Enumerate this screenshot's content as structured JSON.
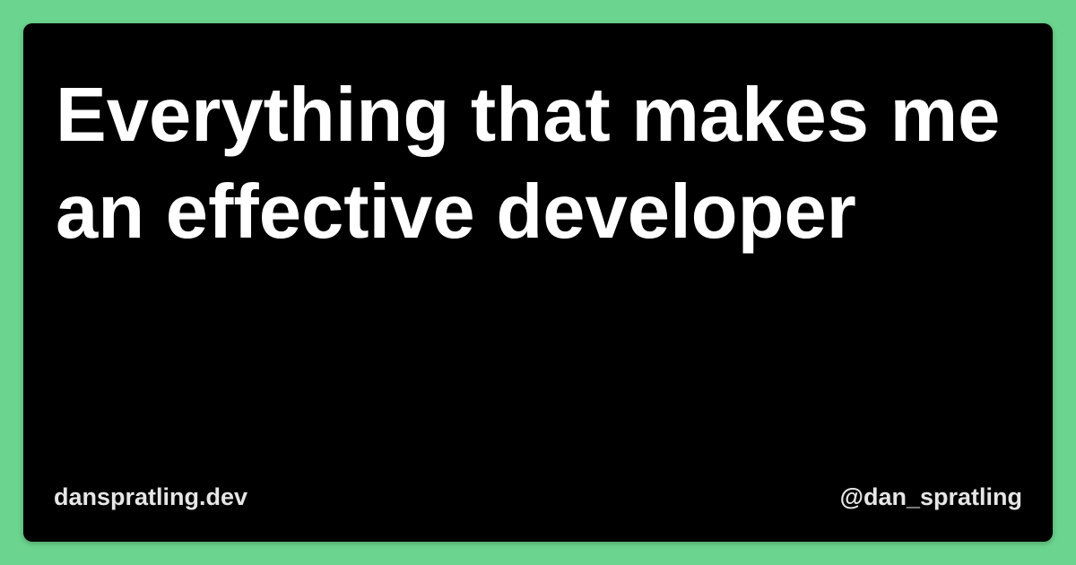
{
  "card": {
    "title": "Everything that makes me an effective developer",
    "site": "danspratling.dev",
    "handle": "@dan_spratling"
  },
  "colors": {
    "background": "#6bd48e",
    "card": "#000000",
    "title_text": "#ffffff",
    "footer_text": "#e6e6e6"
  }
}
